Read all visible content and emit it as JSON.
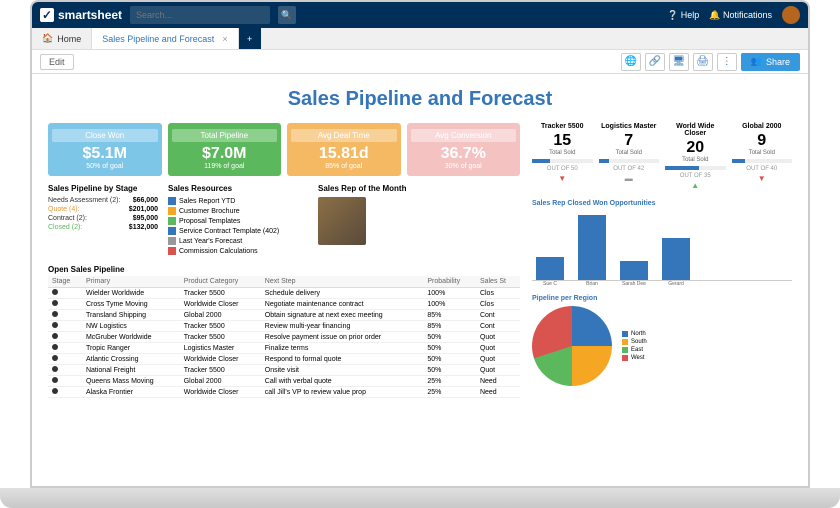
{
  "header": {
    "brand": "smartsheet",
    "search_placeholder": "Search...",
    "help_label": "Help",
    "notifications_label": "Notifications"
  },
  "tabs": {
    "home_label": "Home",
    "active_tab": "Sales Pipeline and Forecast"
  },
  "toolbar": {
    "edit_label": "Edit",
    "share_label": "Share"
  },
  "page_title": "Sales Pipeline and Forecast",
  "kpis": [
    {
      "title": "Close Won",
      "value": "$5.1M",
      "sub": "50% of goal"
    },
    {
      "title": "Total Pipeline",
      "value": "$7.0M",
      "sub": "119% of goal"
    },
    {
      "title": "Avg Deal Time",
      "value": "15.81d",
      "sub": "85% of goal"
    },
    {
      "title": "Avg Conversion",
      "value": "36.7%",
      "sub": "30% of goal"
    }
  ],
  "pipeline_by_stage": {
    "title": "Sales Pipeline by Stage",
    "rows": [
      {
        "name": "Needs Assessment (2):",
        "value": "$66,000"
      },
      {
        "name": "Quote (4):",
        "value": "$201,000"
      },
      {
        "name": "Contract (2):",
        "value": "$95,000"
      },
      {
        "name": "Closed (2):",
        "value": "$132,000"
      }
    ]
  },
  "resources": {
    "title": "Sales Resources",
    "items": [
      "Sales Report YTD",
      "Customer Brochure",
      "Proposal Templates",
      "Service Contract Template (402)",
      "Last Year's Forecast",
      "Commission Calculations"
    ]
  },
  "rep_of_month": {
    "title": "Sales Rep of the Month"
  },
  "open_pipeline": {
    "title": "Open Sales Pipeline",
    "columns": [
      "Stage",
      "Primary",
      "Product Category",
      "Next Step",
      "Probability",
      "Sales St"
    ],
    "rows": [
      {
        "primary": "Wielder Worldwide",
        "product": "Tracker 5500",
        "next": "Schedule delivery",
        "prob": "100%",
        "stage": "Clos"
      },
      {
        "primary": "Cross Tyme Moving",
        "product": "Worldwide Closer",
        "next": "Negotiate maintenance contract",
        "prob": "100%",
        "stage": "Clos"
      },
      {
        "primary": "Transland Shipping",
        "product": "Global 2000",
        "next": "Obtain signature at next exec meeting",
        "prob": "85%",
        "stage": "Cont"
      },
      {
        "primary": "NW Logistics",
        "product": "Tracker 5500",
        "next": "Review multi-year financing",
        "prob": "85%",
        "stage": "Cont"
      },
      {
        "primary": "McGruber Worldwide",
        "product": "Tracker 5500",
        "next": "Resolve payment issue on prior order",
        "prob": "50%",
        "stage": "Quot"
      },
      {
        "primary": "Tropic Ranger",
        "product": "Logistics Master",
        "next": "Finalize terms",
        "prob": "50%",
        "stage": "Quot"
      },
      {
        "primary": "Atlantic Crossing",
        "product": "Worldwide Closer",
        "next": "Respond to formal quote",
        "prob": "50%",
        "stage": "Quot"
      },
      {
        "primary": "National Freight",
        "product": "Tracker 5500",
        "next": "Onsite visit",
        "prob": "50%",
        "stage": "Quot"
      },
      {
        "primary": "Queens Mass Moving",
        "product": "Global 2000",
        "next": "Call with verbal quote",
        "prob": "25%",
        "stage": "Need"
      },
      {
        "primary": "Alaska Frontier",
        "product": "Worldwide Closer",
        "next": "call Jill's VP to review value prop",
        "prob": "25%",
        "stage": "Need"
      }
    ]
  },
  "trackers": [
    {
      "title": "Tracker 5500",
      "value": "15",
      "sub": "Total Sold",
      "out": "OUT OF 50",
      "fill": 30,
      "arrow": "down"
    },
    {
      "title": "Logistics Master",
      "value": "7",
      "sub": "Total Sold",
      "out": "OUT OF 42",
      "fill": 17,
      "arrow": "flat"
    },
    {
      "title": "World Wide Closer",
      "value": "20",
      "sub": "Total Sold",
      "out": "OUT OF 35",
      "fill": 57,
      "arrow": "up"
    },
    {
      "title": "Global 2000",
      "value": "9",
      "sub": "Total Sold",
      "out": "OUT OF 40",
      "fill": 23,
      "arrow": "down"
    }
  ],
  "chart_data": [
    {
      "type": "bar",
      "title": "Sales Rep Closed Won Opportunities",
      "categories": [
        "Sue C",
        "Brian",
        "Sarah Dee",
        "Gerard"
      ],
      "values": [
        5,
        14,
        4,
        9
      ],
      "ylim": [
        0,
        14
      ],
      "ylabel": "",
      "xlabel": ""
    },
    {
      "type": "pie",
      "title": "Pipeline per Region",
      "series": [
        {
          "name": "North",
          "value": 25,
          "color": "#3576ba"
        },
        {
          "name": "South",
          "value": 25,
          "color": "#f5a623"
        },
        {
          "name": "East",
          "value": 20,
          "color": "#5cb85c"
        },
        {
          "name": "West",
          "value": 30,
          "color": "#d9534f"
        }
      ]
    }
  ]
}
